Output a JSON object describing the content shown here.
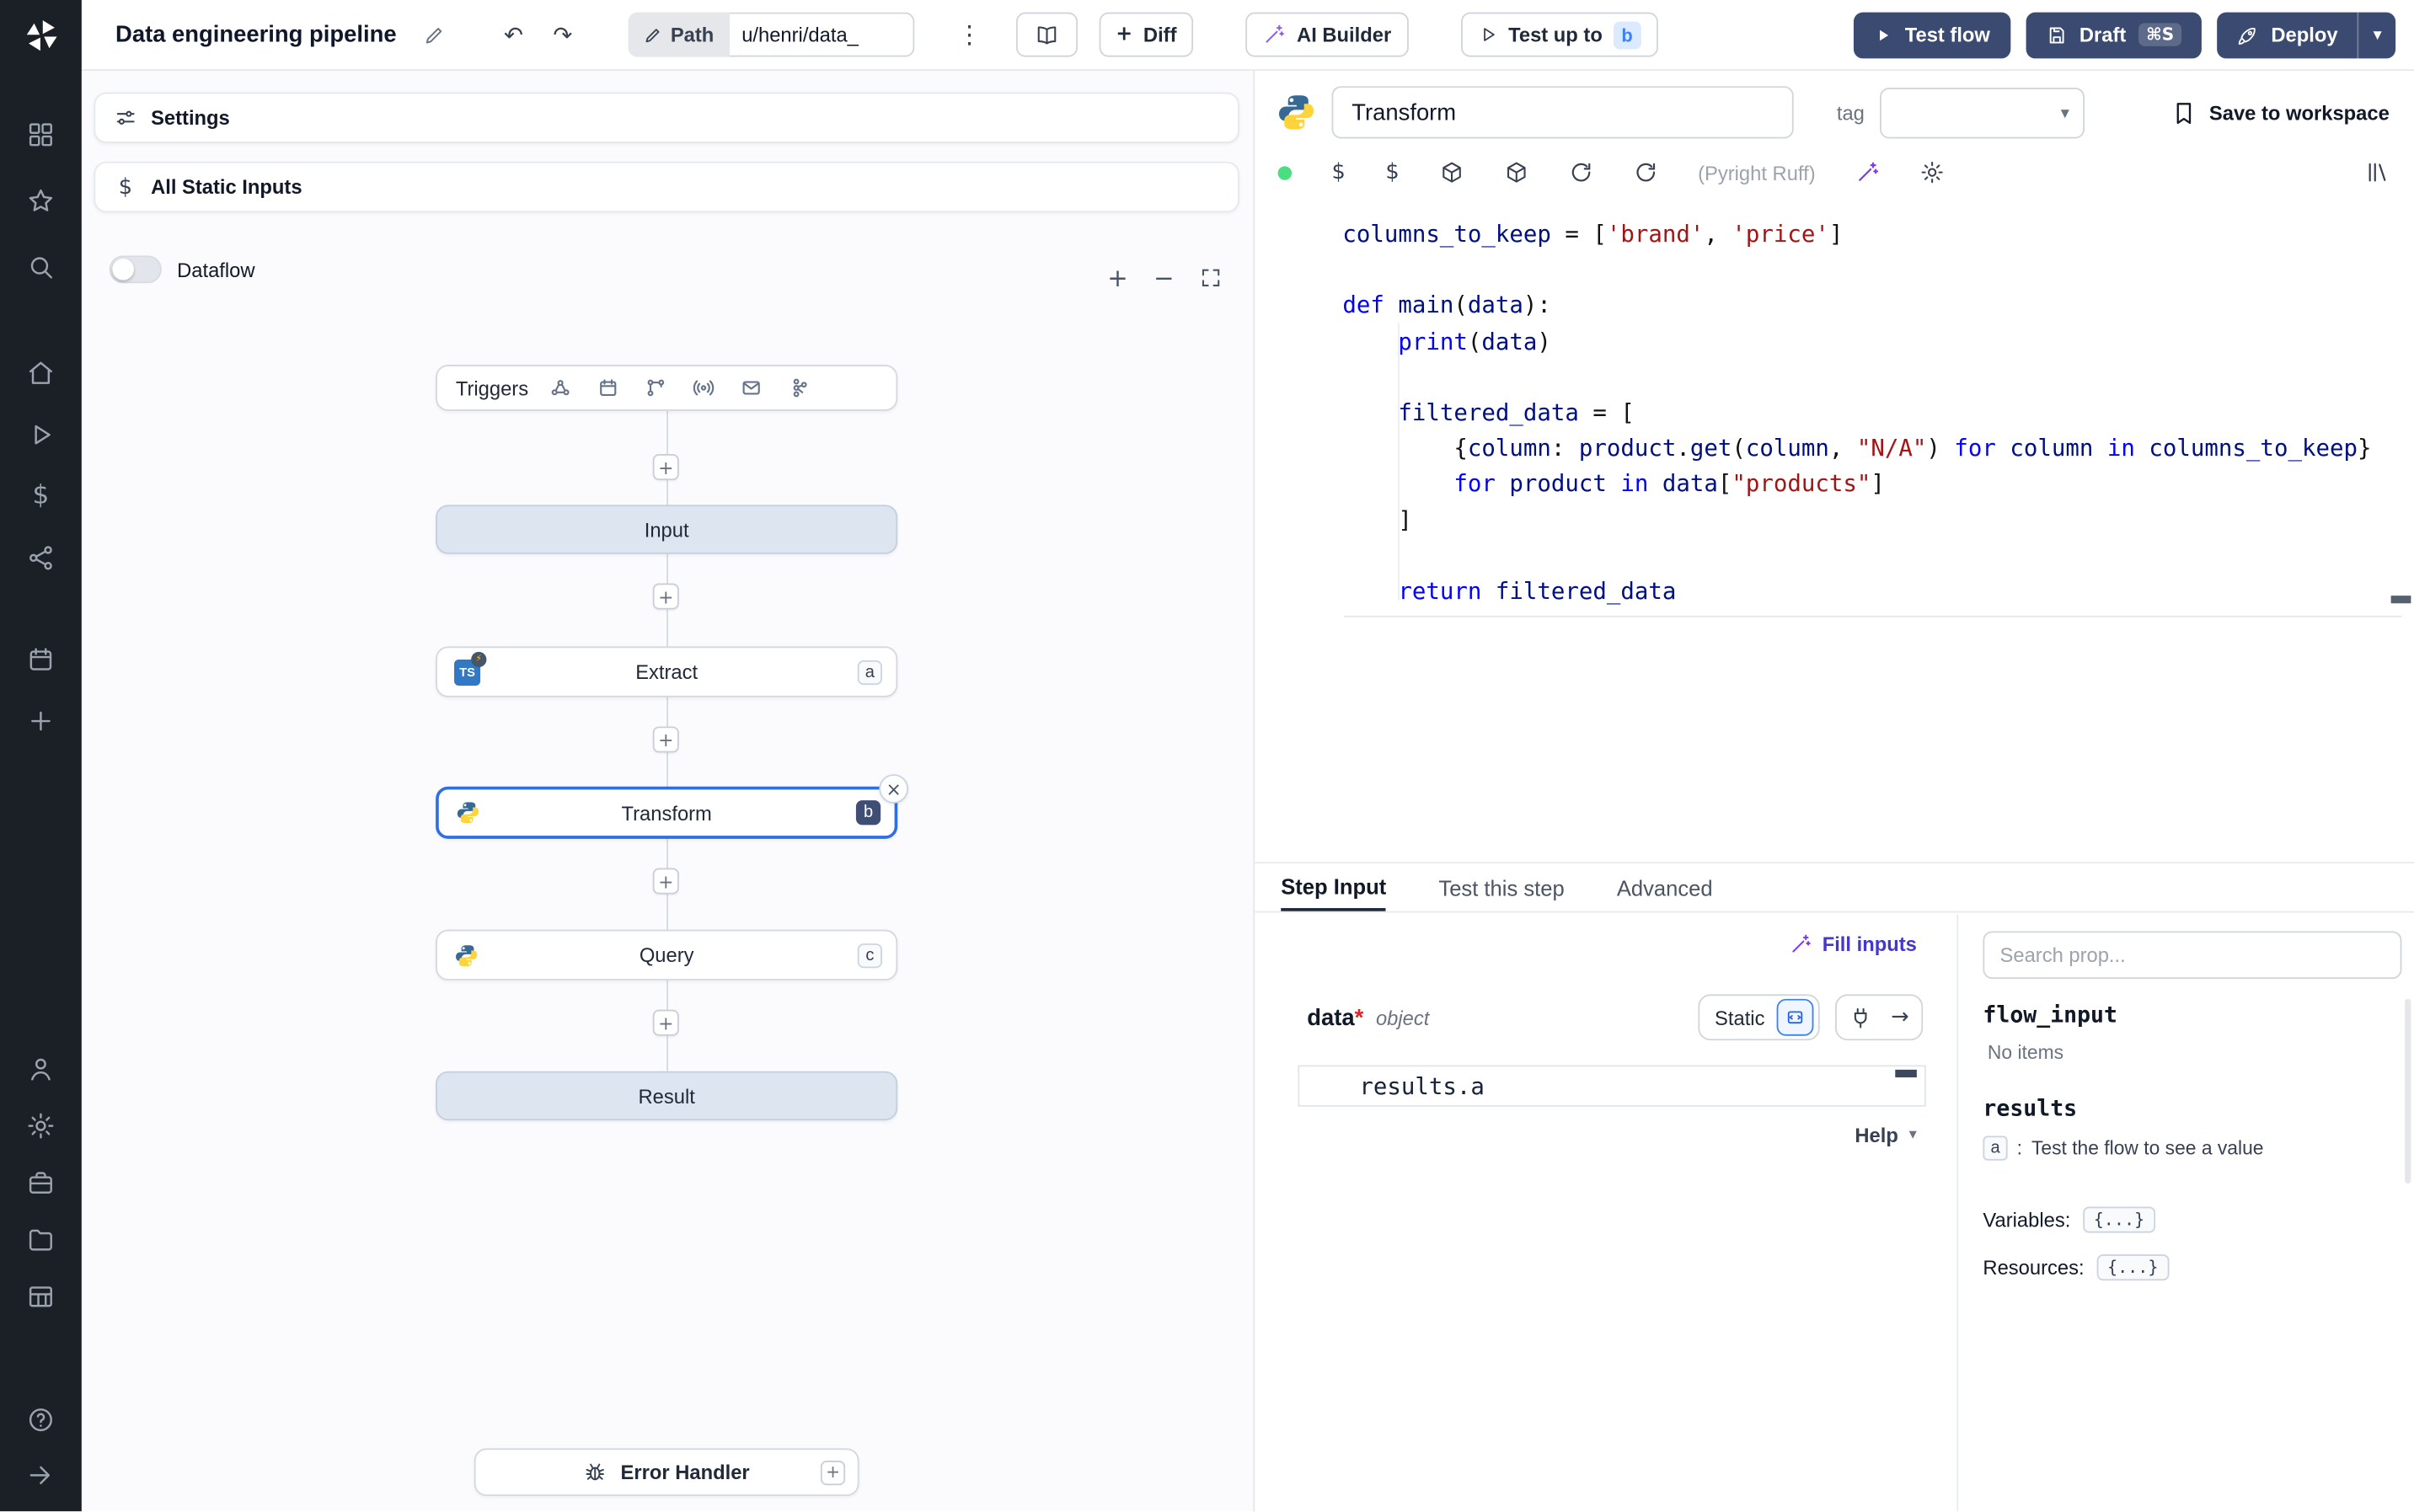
{
  "topbar": {
    "title": "Data engineering pipeline",
    "undo": "↶",
    "redo": "↷",
    "path_label": "Path",
    "path_value": "u/henri/data_",
    "kebab": "⋮",
    "diff_plus": "+",
    "diff_label": "Diff",
    "ai_builder_label": "AI Builder",
    "test_up_to_label": "Test up to",
    "test_up_to_badge": "b",
    "test_flow_label": "Test flow",
    "draft_label": "Draft",
    "draft_kbd": "⌘S",
    "deploy_label": "Deploy",
    "deploy_chevron": "▾"
  },
  "flow_panel": {
    "settings_label": "Settings",
    "static_dollar": "$",
    "static_inputs_label": "All Static Inputs",
    "dataflow_label": "Dataflow",
    "zoom_in": "+",
    "zoom_out": "−",
    "plus_glyph": "+",
    "close_glyph": "×",
    "triggers_label": "Triggers",
    "nodes": {
      "input_label": "Input",
      "extract_label": "Extract",
      "extract_badge": "a",
      "extract_lang": "TS",
      "extract_bolt": "⚡",
      "transform_label": "Transform",
      "transform_badge": "b",
      "query_label": "Query",
      "query_badge": "c",
      "result_label": "Result",
      "error_handler_label": "Error Handler"
    }
  },
  "editor": {
    "step_name": "Transform",
    "tag_label": "tag",
    "tag_chevron": "▾",
    "save_label": "Save to workspace",
    "dollar1": "$",
    "dollar2": "$",
    "lint_label": "(Pyright Ruff)",
    "code": [
      [
        [
          "id",
          "columns_to_keep"
        ],
        [
          "p",
          " = ["
        ],
        [
          "str",
          "'brand'"
        ],
        [
          "p",
          ", "
        ],
        [
          "str",
          "'price'"
        ],
        [
          "p",
          "]"
        ]
      ],
      [],
      [
        [
          "kw",
          "def"
        ],
        [
          "p",
          " "
        ],
        [
          "id",
          "main"
        ],
        [
          "p",
          "("
        ],
        [
          "id",
          "data"
        ],
        [
          "p",
          "):"
        ]
      ],
      [
        [
          "p",
          "    "
        ],
        [
          "kw",
          "print"
        ],
        [
          "p",
          "("
        ],
        [
          "id",
          "data"
        ],
        [
          "p",
          ")"
        ]
      ],
      [],
      [
        [
          "p",
          "    "
        ],
        [
          "id",
          "filtered_data"
        ],
        [
          "p",
          " = ["
        ]
      ],
      [
        [
          "p",
          "        {"
        ],
        [
          "id",
          "column"
        ],
        [
          "p",
          ": "
        ],
        [
          "id",
          "product"
        ],
        [
          "p",
          "."
        ],
        [
          "id",
          "get"
        ],
        [
          "p",
          "("
        ],
        [
          "id",
          "column"
        ],
        [
          "p",
          ", "
        ],
        [
          "str",
          "\"N/A\""
        ],
        [
          "p",
          ") "
        ],
        [
          "kw",
          "for"
        ],
        [
          "p",
          " "
        ],
        [
          "id",
          "column"
        ],
        [
          "p",
          " "
        ],
        [
          "kw",
          "in"
        ],
        [
          "p",
          " "
        ],
        [
          "id",
          "columns_to_keep"
        ],
        [
          "p",
          "}"
        ]
      ],
      [
        [
          "p",
          "        "
        ],
        [
          "kw",
          "for"
        ],
        [
          "p",
          " "
        ],
        [
          "id",
          "product"
        ],
        [
          "p",
          " "
        ],
        [
          "kw",
          "in"
        ],
        [
          "p",
          " "
        ],
        [
          "id",
          "data"
        ],
        [
          "p",
          "["
        ],
        [
          "str",
          "\"products\""
        ],
        [
          "p",
          "]"
        ]
      ],
      [
        [
          "p",
          "    ]"
        ]
      ],
      [],
      [
        [
          "p",
          "    "
        ],
        [
          "kw",
          "return"
        ],
        [
          "p",
          " "
        ],
        [
          "id",
          "filtered_data"
        ]
      ]
    ]
  },
  "tabs": {
    "t0": "Step Input",
    "t1": "Test this step",
    "t2": "Advanced"
  },
  "step_input": {
    "fill_inputs_label": "Fill inputs",
    "arg_name": "data",
    "required": "*",
    "arg_type": "object",
    "static_label": "Static",
    "expr_value": "results.a",
    "arrow": "→",
    "help_label": "Help",
    "help_chevron": "▾"
  },
  "prop_picker": {
    "search_placeholder": "Search prop...",
    "flow_input_label": "flow_input",
    "flow_input_empty": "No items",
    "results_label": "results",
    "result_key": "a",
    "result_sep": ":",
    "result_hint": "Test the flow to see a value",
    "variables_label": "Variables:",
    "variables_value": "{...}",
    "resources_label": "Resources:",
    "resources_value": "{...}"
  },
  "colors": {
    "selected_node_blue": "#2f6fe4",
    "dark_button": "#3a4a70",
    "ai_purple": "#7c3aed",
    "status_green": "#4ade80",
    "badge_blue_bg": "#dbeafe",
    "badge_blue_text": "#3b82f6"
  }
}
